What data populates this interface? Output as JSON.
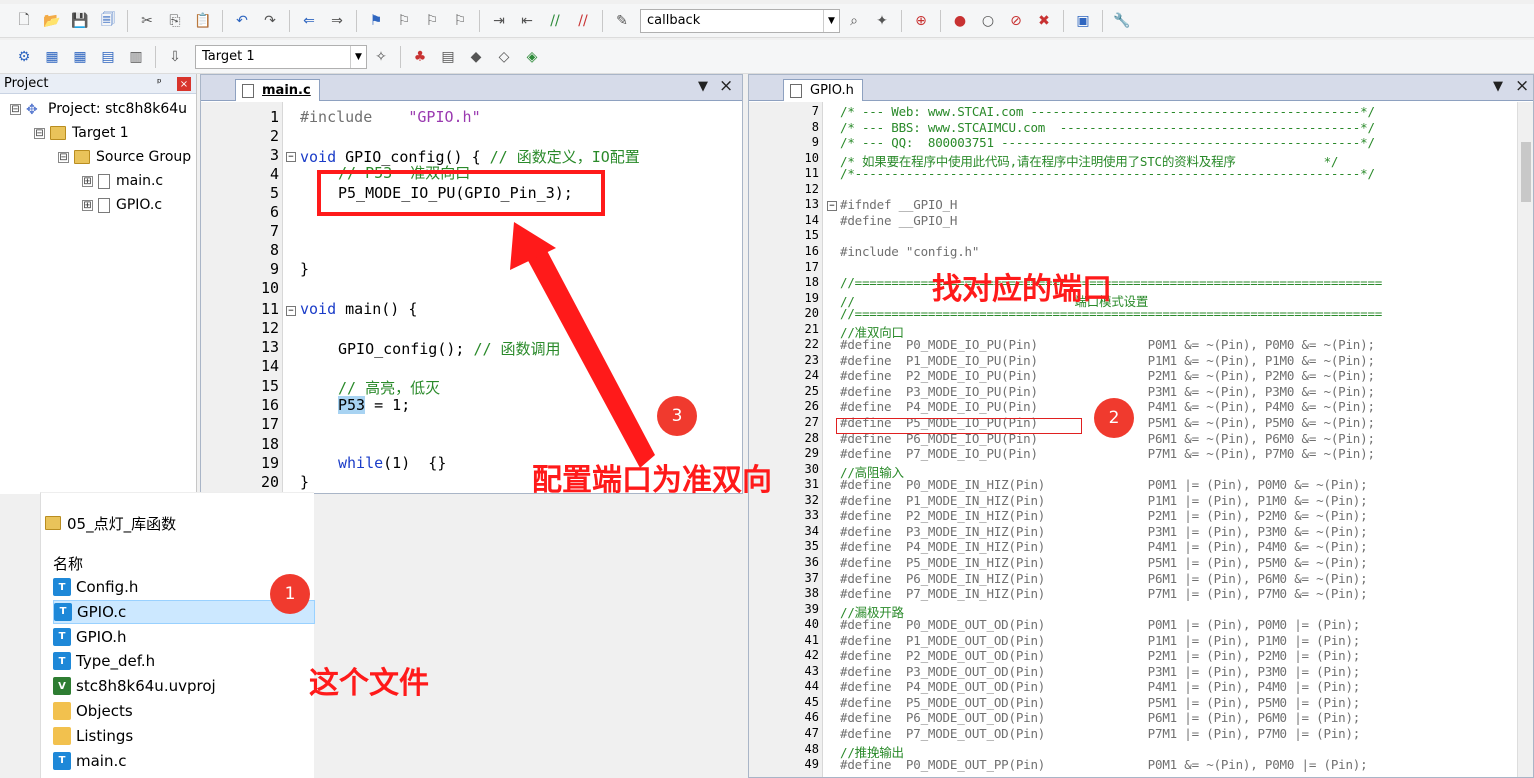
{
  "toolbar": {
    "target_combo": "callback",
    "target_select": "Target 1"
  },
  "project_panel": {
    "title": "Project",
    "pin": "ᵖ",
    "close": "×",
    "tree": [
      {
        "label": "Project: stc8h8k64u",
        "toggle": "⊟"
      },
      {
        "label": "Target 1",
        "toggle": "⊟"
      },
      {
        "label": "Source Group",
        "toggle": "⊟"
      },
      {
        "label": "main.c",
        "toggle": "⊞"
      },
      {
        "label": "GPIO.c",
        "toggle": "⊞"
      }
    ]
  },
  "main_editor": {
    "tab": "main.c",
    "ctrl_dropdown": "▼",
    "ctrl_close": "×",
    "line_numbers": [
      "1",
      "2",
      "3",
      "4",
      "5",
      "6",
      "7",
      "8",
      "9",
      "10",
      "11",
      "12",
      "13",
      "14",
      "15",
      "16",
      "17",
      "18",
      "19",
      "20"
    ],
    "code": {
      "l1a": "#include",
      "l1b": "\"GPIO.h\"",
      "l3a": "void",
      "l3b": " GPIO_config() { ",
      "l3c": "// 函数定义，IO配置",
      "l4": "// P53  准双向口",
      "l5": "P5_MODE_IO_PU(GPIO_Pin_3);",
      "l9": "}",
      "l11a": "void",
      "l11b": " main() {",
      "l13a": "GPIO_config(); ",
      "l13b": "// 函数调用",
      "l15": "// 高亮，低灭",
      "l16a": "P53",
      "l16b": " = 1;",
      "l19a": "while",
      "l19b": "(1)  {}",
      "l20": "}"
    }
  },
  "gpio_editor": {
    "tab": "GPIO.h",
    "ctrl_dropdown": "▼",
    "ctrl_close": "×",
    "lines": [
      {
        "n": "7",
        "text": "/* --- Web: www.STCAI.com ---------------------------------------------*/",
        "cls": "c-green"
      },
      {
        "n": "8",
        "text": "/* --- BBS: www.STCAIMCU.com  -----------------------------------------*/",
        "cls": "c-green"
      },
      {
        "n": "9",
        "text": "/* --- QQ:  800003751 -------------------------------------------------*/",
        "cls": "c-green"
      },
      {
        "n": "10",
        "text": "/* 如果要在程序中使用此代码,请在程序中注明使用了STC的资料及程序            */",
        "cls": "c-green"
      },
      {
        "n": "11",
        "text": "/*---------------------------------------------------------------------*/",
        "cls": "c-green"
      },
      {
        "n": "12",
        "text": "",
        "cls": ""
      },
      {
        "n": "13",
        "text": "#ifndef __GPIO_H",
        "cls": "c-grey"
      },
      {
        "n": "14",
        "text": "#define __GPIO_H",
        "cls": "c-grey"
      },
      {
        "n": "15",
        "text": "",
        "cls": ""
      },
      {
        "n": "16",
        "text": "#include \"config.h\"",
        "cls": "c-grey"
      },
      {
        "n": "17",
        "text": "",
        "cls": ""
      },
      {
        "n": "18",
        "text": "//========================================================================",
        "cls": "c-green"
      },
      {
        "n": "19",
        "text": "//                              端口模式设置",
        "cls": "c-green"
      },
      {
        "n": "20",
        "text": "//========================================================================",
        "cls": "c-green"
      },
      {
        "n": "21",
        "text": "//准双向口",
        "cls": "c-green"
      },
      {
        "n": "22",
        "text": "#define  P0_MODE_IO_PU(Pin)               P0M1 &= ~(Pin), P0M0 &= ~(Pin);",
        "cls": "c-grey"
      },
      {
        "n": "23",
        "text": "#define  P1_MODE_IO_PU(Pin)               P1M1 &= ~(Pin), P1M0 &= ~(Pin);",
        "cls": "c-grey"
      },
      {
        "n": "24",
        "text": "#define  P2_MODE_IO_PU(Pin)               P2M1 &= ~(Pin), P2M0 &= ~(Pin);",
        "cls": "c-grey"
      },
      {
        "n": "25",
        "text": "#define  P3_MODE_IO_PU(Pin)               P3M1 &= ~(Pin), P3M0 &= ~(Pin);",
        "cls": "c-grey"
      },
      {
        "n": "26",
        "text": "#define  P4_MODE_IO_PU(Pin)               P4M1 &= ~(Pin), P4M0 &= ~(Pin);",
        "cls": "c-grey"
      },
      {
        "n": "27",
        "text": "#define  P5_MODE_IO_PU(Pin)               P5M1 &= ~(Pin), P5M0 &= ~(Pin);",
        "cls": "c-grey"
      },
      {
        "n": "28",
        "text": "#define  P6_MODE_IO_PU(Pin)               P6M1 &= ~(Pin), P6M0 &= ~(Pin);",
        "cls": "c-grey"
      },
      {
        "n": "29",
        "text": "#define  P7_MODE_IO_PU(Pin)               P7M1 &= ~(Pin), P7M0 &= ~(Pin);",
        "cls": "c-grey"
      },
      {
        "n": "30",
        "text": "//高阻输入",
        "cls": "c-green"
      },
      {
        "n": "31",
        "text": "#define  P0_MODE_IN_HIZ(Pin)              P0M1 |= (Pin), P0M0 &= ~(Pin);",
        "cls": "c-grey"
      },
      {
        "n": "32",
        "text": "#define  P1_MODE_IN_HIZ(Pin)              P1M1 |= (Pin), P1M0 &= ~(Pin);",
        "cls": "c-grey"
      },
      {
        "n": "33",
        "text": "#define  P2_MODE_IN_HIZ(Pin)              P2M1 |= (Pin), P2M0 &= ~(Pin);",
        "cls": "c-grey"
      },
      {
        "n": "34",
        "text": "#define  P3_MODE_IN_HIZ(Pin)              P3M1 |= (Pin), P3M0 &= ~(Pin);",
        "cls": "c-grey"
      },
      {
        "n": "35",
        "text": "#define  P4_MODE_IN_HIZ(Pin)              P4M1 |= (Pin), P4M0 &= ~(Pin);",
        "cls": "c-grey"
      },
      {
        "n": "36",
        "text": "#define  P5_MODE_IN_HIZ(Pin)              P5M1 |= (Pin), P5M0 &= ~(Pin);",
        "cls": "c-grey"
      },
      {
        "n": "37",
        "text": "#define  P6_MODE_IN_HIZ(Pin)              P6M1 |= (Pin), P6M0 &= ~(Pin);",
        "cls": "c-grey"
      },
      {
        "n": "38",
        "text": "#define  P7_MODE_IN_HIZ(Pin)              P7M1 |= (Pin), P7M0 &= ~(Pin);",
        "cls": "c-grey"
      },
      {
        "n": "39",
        "text": "//漏极开路",
        "cls": "c-green"
      },
      {
        "n": "40",
        "text": "#define  P0_MODE_OUT_OD(Pin)              P0M1 |= (Pin), P0M0 |= (Pin);",
        "cls": "c-grey"
      },
      {
        "n": "41",
        "text": "#define  P1_MODE_OUT_OD(Pin)              P1M1 |= (Pin), P1M0 |= (Pin);",
        "cls": "c-grey"
      },
      {
        "n": "42",
        "text": "#define  P2_MODE_OUT_OD(Pin)              P2M1 |= (Pin), P2M0 |= (Pin);",
        "cls": "c-grey"
      },
      {
        "n": "43",
        "text": "#define  P3_MODE_OUT_OD(Pin)              P3M1 |= (Pin), P3M0 |= (Pin);",
        "cls": "c-grey"
      },
      {
        "n": "44",
        "text": "#define  P4_MODE_OUT_OD(Pin)              P4M1 |= (Pin), P4M0 |= (Pin);",
        "cls": "c-grey"
      },
      {
        "n": "45",
        "text": "#define  P5_MODE_OUT_OD(Pin)              P5M1 |= (Pin), P5M0 |= (Pin);",
        "cls": "c-grey"
      },
      {
        "n": "46",
        "text": "#define  P6_MODE_OUT_OD(Pin)              P6M1 |= (Pin), P6M0 |= (Pin);",
        "cls": "c-grey"
      },
      {
        "n": "47",
        "text": "#define  P7_MODE_OUT_OD(Pin)              P7M1 |= (Pin), P7M0 |= (Pin);",
        "cls": "c-grey"
      },
      {
        "n": "48",
        "text": "//推挽输出",
        "cls": "c-green"
      },
      {
        "n": "49",
        "text": "#define  P0_MODE_OUT_PP(Pin)              P0M1 &= ~(Pin), P0M0 |= (Pin);",
        "cls": "c-grey"
      }
    ]
  },
  "explorer": {
    "folder": "05_点灯_库函数",
    "header": "名称",
    "files": [
      {
        "name": "Config.h",
        "type": "h"
      },
      {
        "name": "GPIO.c",
        "type": "c"
      },
      {
        "name": "GPIO.h",
        "type": "h"
      },
      {
        "name": "Type_def.h",
        "type": "h"
      },
      {
        "name": "stc8h8k64u.uvproj",
        "type": "uv"
      },
      {
        "name": "Objects",
        "type": "f"
      },
      {
        "name": "Listings",
        "type": "f"
      },
      {
        "name": "main.c",
        "type": "c"
      }
    ]
  },
  "annotations": {
    "badge1": "1",
    "badge2": "2",
    "badge3": "3",
    "callout_port": "找对应的端口",
    "callout_config": "配置端口为准双向",
    "callout_file": "这个文件",
    "accent_red": "#ff1a1a"
  }
}
